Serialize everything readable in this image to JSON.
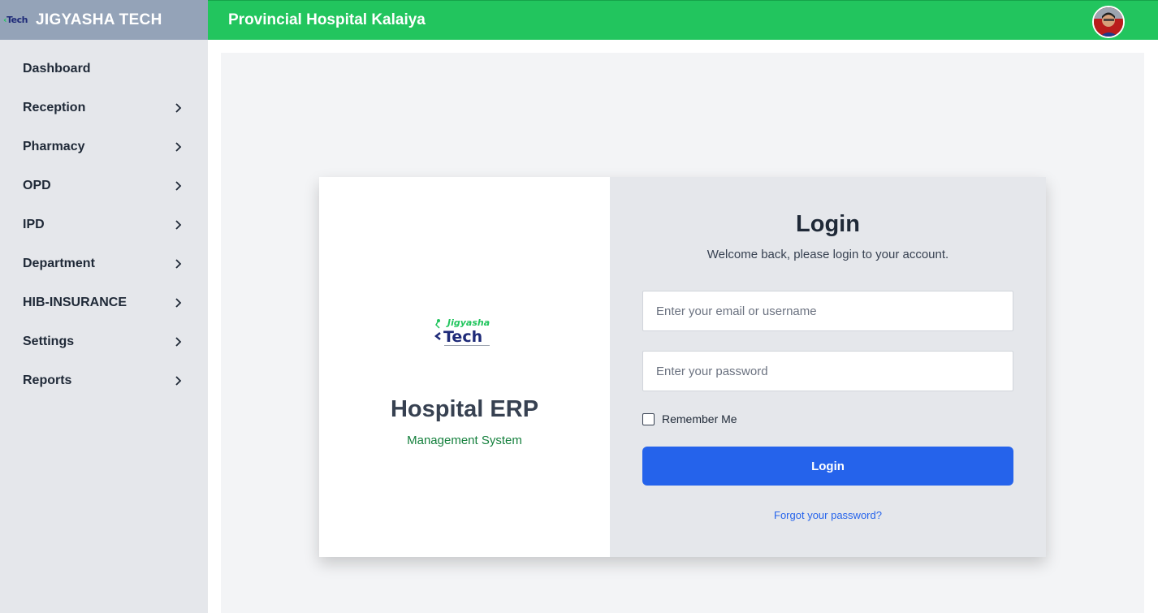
{
  "brand": {
    "name": "JIGYASHA TECH",
    "logo_text": "Tech"
  },
  "topbar": {
    "title": "Provincial Hospital Kalaiya"
  },
  "sidebar": {
    "items": [
      {
        "label": "Dashboard",
        "has_submenu": false
      },
      {
        "label": "Reception",
        "has_submenu": true
      },
      {
        "label": "Pharmacy",
        "has_submenu": true
      },
      {
        "label": "OPD",
        "has_submenu": true
      },
      {
        "label": "IPD",
        "has_submenu": true
      },
      {
        "label": "Department",
        "has_submenu": true
      },
      {
        "label": "HIB-INSURANCE",
        "has_submenu": true
      },
      {
        "label": "Settings",
        "has_submenu": true
      },
      {
        "label": "Reports",
        "has_submenu": true
      }
    ]
  },
  "card": {
    "logo_text_top": "Jigyasha",
    "logo_text_main": "Tech",
    "title": "Hospital ERP",
    "subtitle": "Management System"
  },
  "login": {
    "title": "Login",
    "subtitle": "Welcome back, please login to your account.",
    "email_placeholder": "Enter your email or username",
    "email_value": "",
    "password_placeholder": "Enter your password",
    "password_value": "",
    "remember_label": "Remember Me",
    "remember_checked": false,
    "button_label": "Login",
    "forgot_label": "Forgot your password?"
  },
  "colors": {
    "topbar": "#22c55e",
    "brand_bg": "#94a3b8",
    "sidebar_bg": "#e5e7eb",
    "primary_button": "#2563eb",
    "subtitle_green": "#15803d"
  }
}
